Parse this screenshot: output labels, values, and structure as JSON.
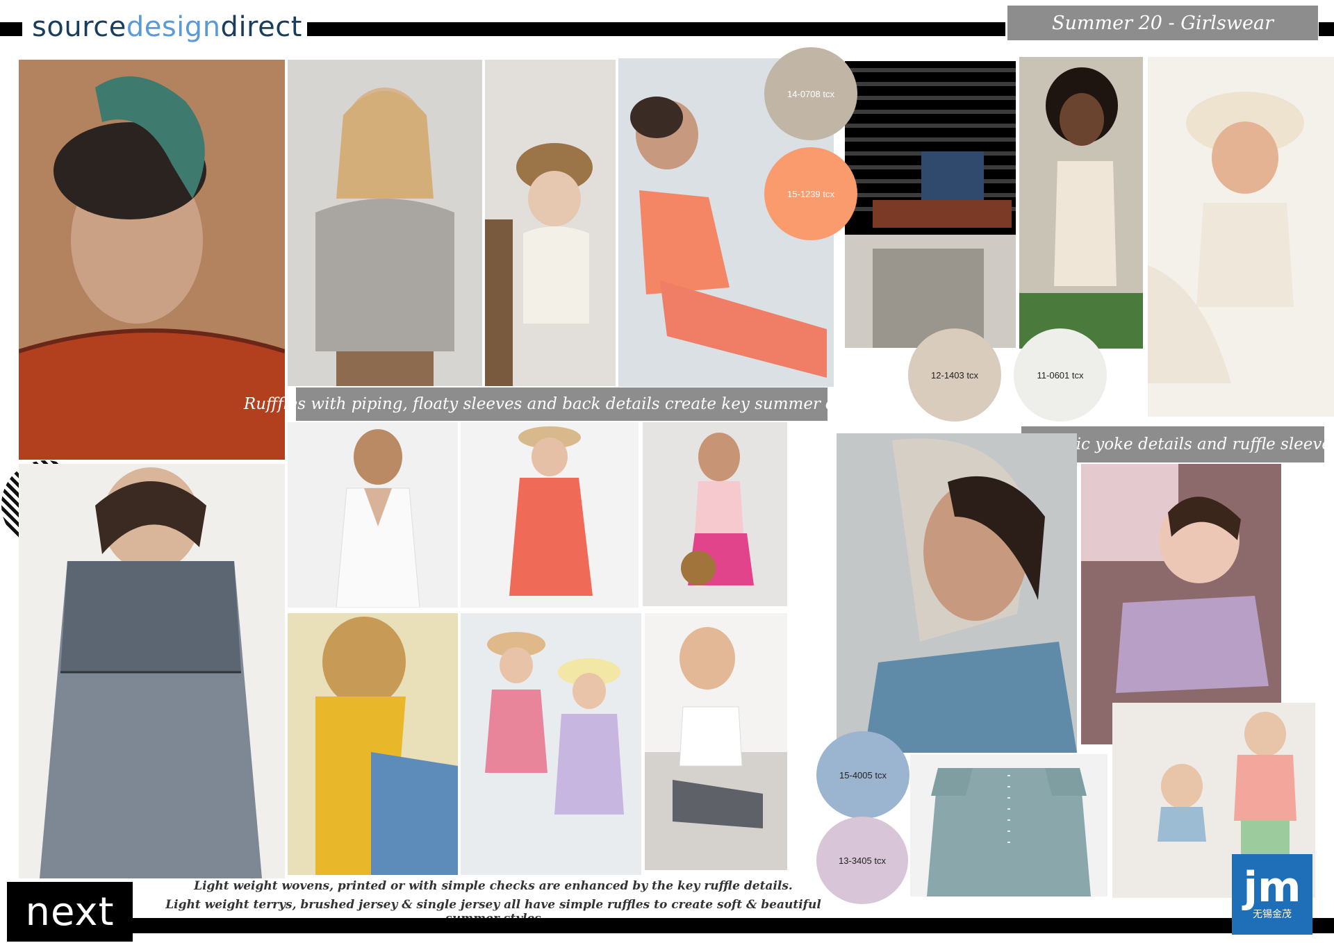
{
  "header": {
    "logo_prefix": "source",
    "logo_mid": "design",
    "logo_suffix": "direct",
    "season_title": "Summer 20 - Girlswear"
  },
  "captions": {
    "ruffles": "Rufffles with piping, floaty sleeves and back details create key summer details",
    "yoke": "Self fabric yoke details and ruffle sleeves"
  },
  "swatches": [
    {
      "code": "14-0708 tcx",
      "color": "#c1b6a6"
    },
    {
      "code": "15-1239 tcx",
      "color": "#fa9b6d"
    },
    {
      "code": "12-1403 tcx",
      "color": "#d9ccbc"
    },
    {
      "code": "11-0601 tcx",
      "color": "#eeefea"
    },
    {
      "code": "15-4005 tcx",
      "color": "#9bb4cf"
    },
    {
      "code": "13-3405 tcx",
      "color": "#d9c5d8"
    }
  ],
  "footer": {
    "line1": "Light weight wovens, printed or with simple checks are enhanced by the key ruffle details.",
    "line2": "Light weight terrys, brushed jersey & single jersey all have simple ruffles to create soft & beautiful summer styles",
    "brand": "next",
    "badge_logo": "jm",
    "badge_text": "无锡金茂"
  },
  "colors": {
    "accent_grey": "#8d8d8d",
    "logo_dark": "#1b3d5c",
    "logo_light": "#5b9bd5",
    "badge_blue": "#1e6fb8"
  }
}
